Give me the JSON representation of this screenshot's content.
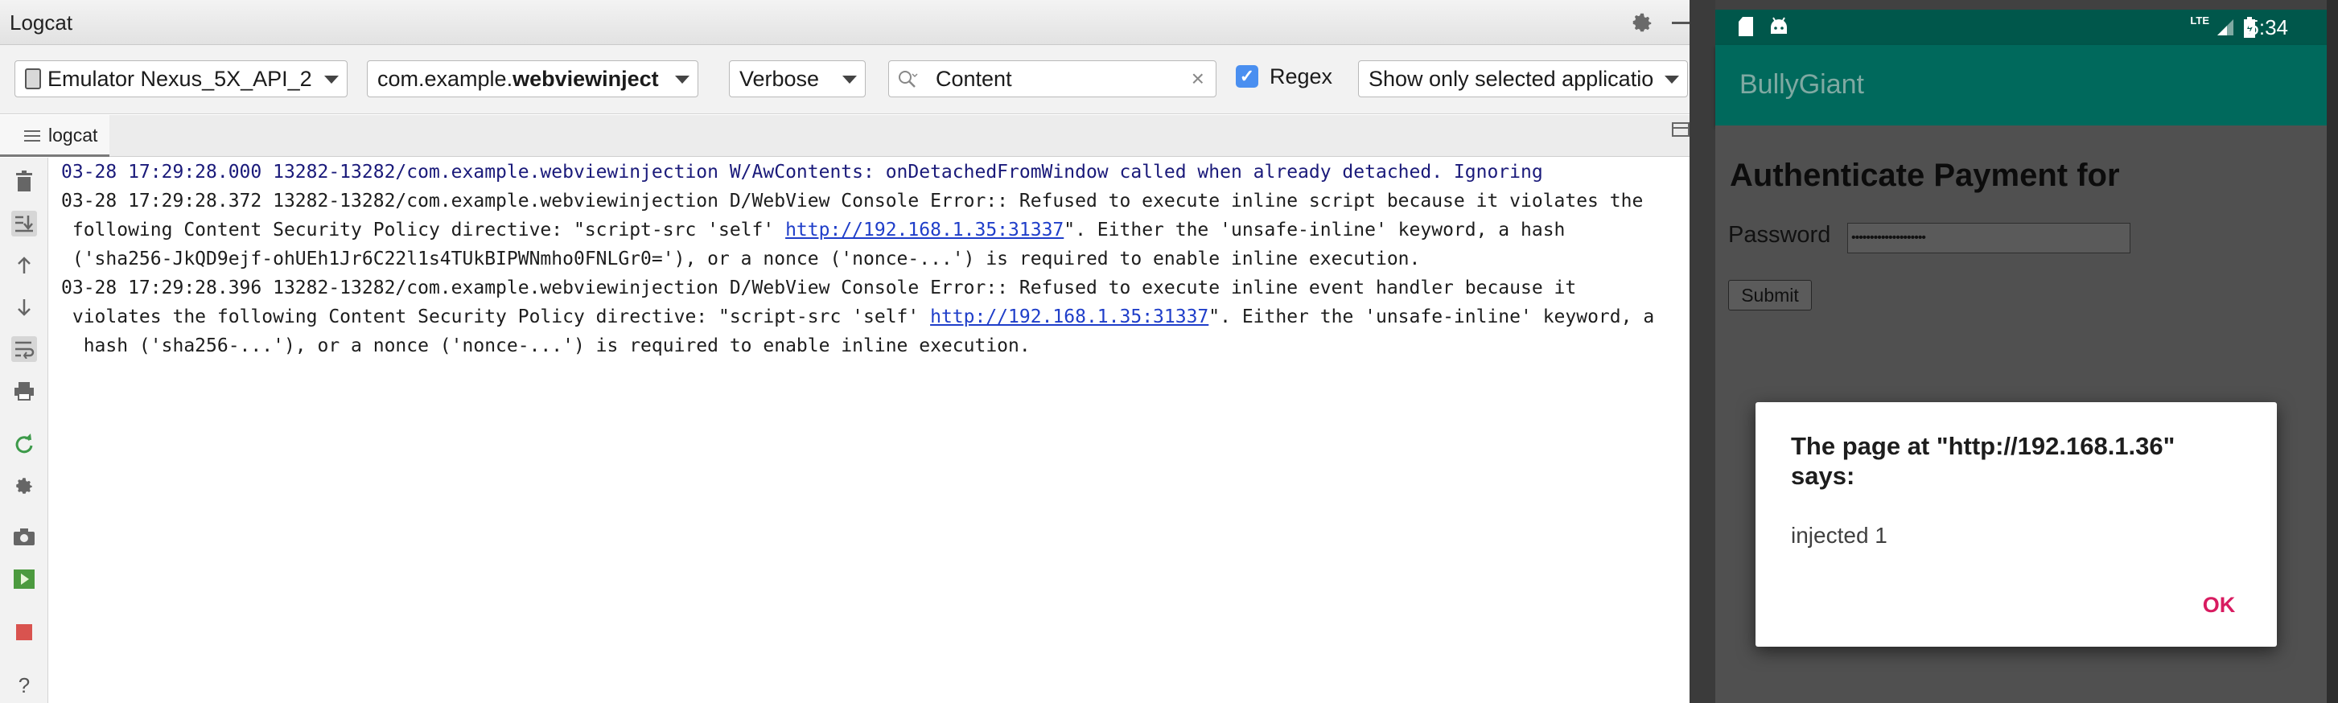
{
  "logcat": {
    "title": "Logcat",
    "toolbar": {
      "device": "Emulator Nexus_5X_API_2",
      "package_prefix": "com.example.",
      "package_bold": "webviewinject",
      "log_level": "Verbose",
      "search_value": "Content",
      "clear_symbol": "×",
      "regex_label": "Regex",
      "regex_checked": true,
      "filter": "Show only selected applicatio"
    },
    "tab_label": "logcat",
    "side_icons": [
      "trash-icon",
      "scroll-to-end-icon",
      "up-arrow-icon",
      "down-arrow-icon",
      "soft-wrap-icon",
      "print-icon",
      "restart-icon",
      "gear-icon",
      "camera-icon",
      "record-icon",
      "stop-icon",
      "help-icon"
    ],
    "help_symbol": "?",
    "log_lines": [
      {
        "text": "03-28 17:29:28.000 13282-13282/com.example.webviewinjection W/AwContents: onDetachedFromWindow called when already detached. Ignoring",
        "level": "info"
      },
      {
        "pre": "03-28 17:29:28.372 13282-13282/com.example.webviewinjection D/WebView Console Error:: Refused to execute inline script because it violates the",
        "level": "normal"
      },
      {
        "pre": " following Content Security Policy directive: \"script-src 'self' ",
        "link": "http://192.168.1.35:31337",
        "post": "\". Either the 'unsafe-inline' keyword, a hash",
        "level": "normal"
      },
      {
        "pre": " ('sha256-JkQD9ejf-ohUEh1Jr6C22l1s4TUkBIPWNmho0FNLGr0='), or a nonce ('nonce-...') is required to enable inline execution.",
        "level": "normal"
      },
      {
        "pre": "03-28 17:29:28.396 13282-13282/com.example.webviewinjection D/WebView Console Error:: Refused to execute inline event handler because it",
        "level": "normal"
      },
      {
        "pre": " violates the following Content Security Policy directive: \"script-src 'self' ",
        "link": "http://192.168.1.35:31337",
        "post": "\". Either the 'unsafe-inline' keyword, a",
        "level": "normal"
      },
      {
        "pre": "  hash ('sha256-...'), or a nonce ('nonce-...') is required to enable inline execution.",
        "level": "normal"
      }
    ]
  },
  "emulator": {
    "status_time": "5:34",
    "status_network": "LTE",
    "app_title": "BullyGiant",
    "page_heading": "Authenticate Payment for",
    "password_label": "Password",
    "password_value": "••••••••••••••••••••",
    "submit_label": "Submit",
    "dialog": {
      "title": "The page at \"http://192.168.1.36\" says:",
      "message": "injected 1",
      "ok_label": "OK"
    }
  },
  "colors": {
    "accent_blue": "#4a8ff0",
    "teal_dark": "#00574b",
    "teal": "#00695c",
    "dialog_button": "#d81b60",
    "link": "#1f3ec9"
  }
}
